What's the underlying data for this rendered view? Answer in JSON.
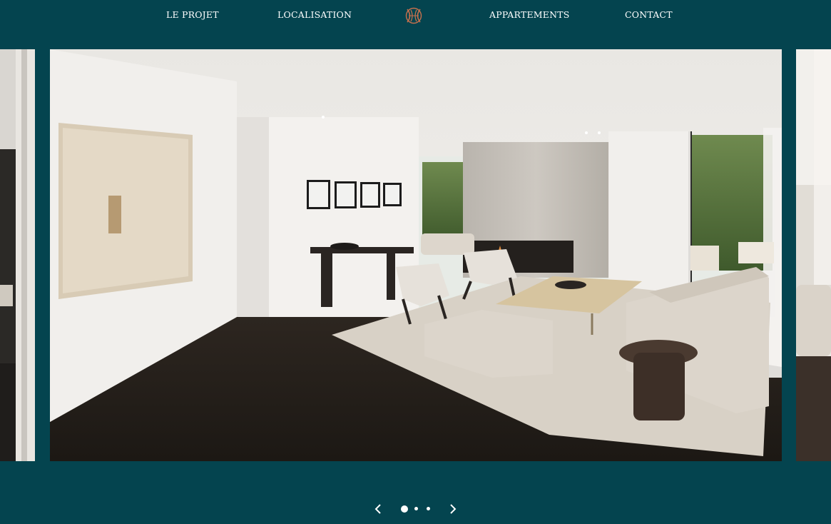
{
  "nav": {
    "left_items": [
      {
        "label": "LE PROJET"
      },
      {
        "label": "LOCALISATION"
      }
    ],
    "right_items": [
      {
        "label": "APPARTEMENTS"
      },
      {
        "label": "CONTACT"
      }
    ],
    "logo_icon": "monogram-logo-icon"
  },
  "colors": {
    "background": "#04444f",
    "nav_text": "#ffffff",
    "logo_accent": "#c8714d"
  },
  "carousel": {
    "slide_count": 3,
    "active_index": 0,
    "prev_icon": "chevron-left-icon",
    "next_icon": "chevron-right-icon"
  }
}
